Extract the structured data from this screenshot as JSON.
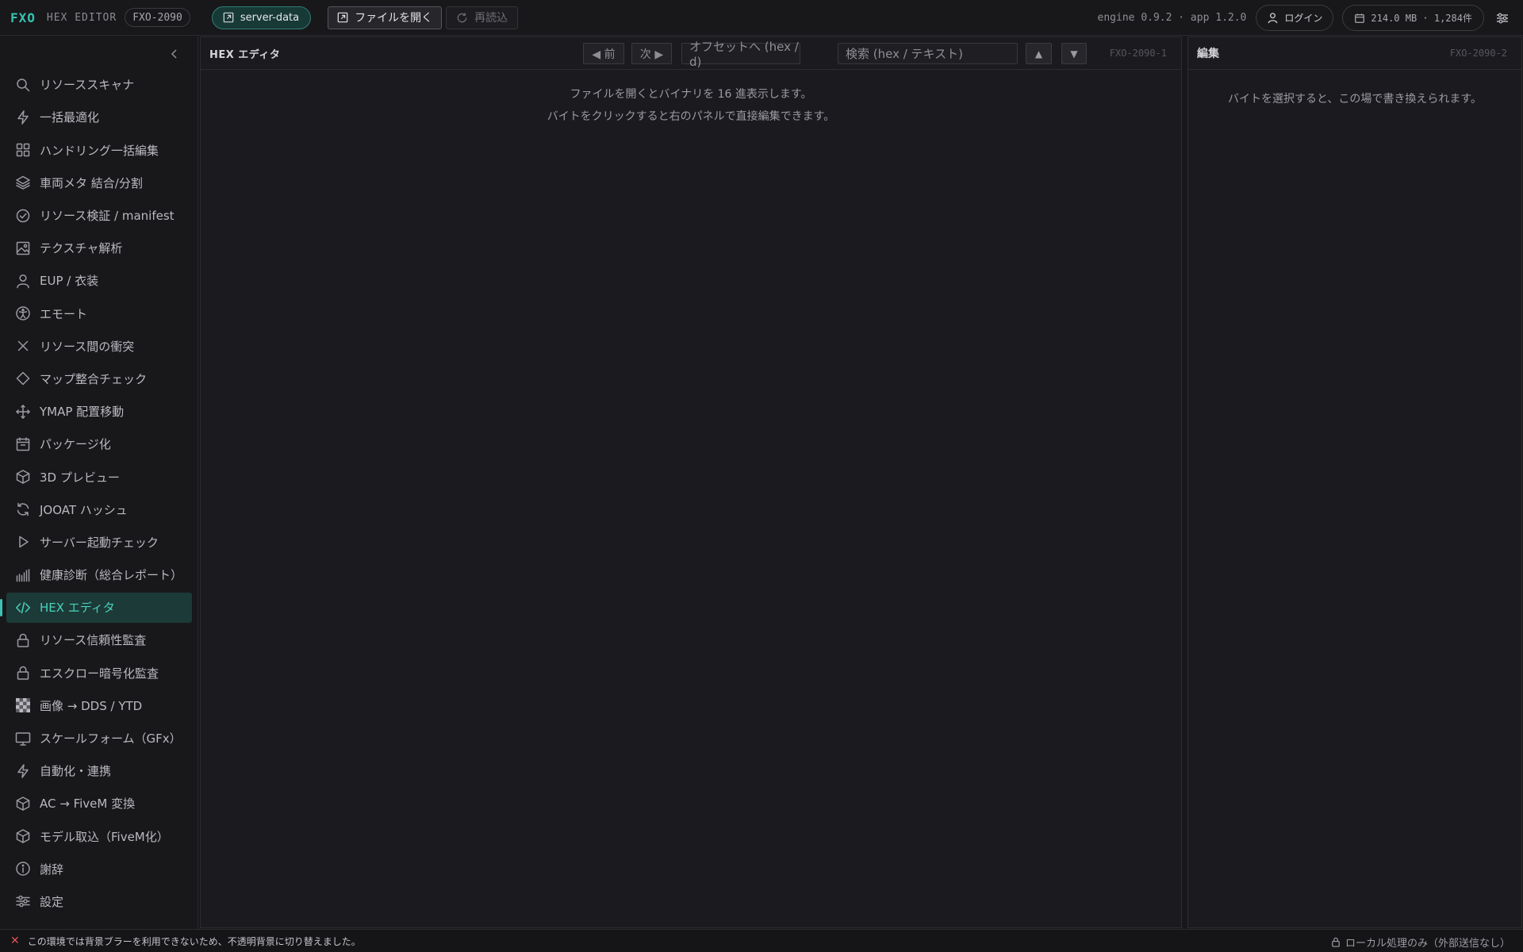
{
  "header": {
    "brand": "FXO",
    "subtitle": "HEX EDITOR",
    "build_id": "FXO-2090",
    "server_button": "server-data",
    "open_file_button": "ファイルを開く",
    "reload_button": "再読込",
    "version": "engine 0.9.2 · app 1.2.0",
    "login_button": "ログイン",
    "memory": "214.0 MB · 1,284件"
  },
  "sidebar": {
    "items": [
      {
        "label": "リソーススキャナ",
        "icon": "search-icon"
      },
      {
        "label": "一括最適化",
        "icon": "bolt-icon"
      },
      {
        "label": "ハンドリング一括編集",
        "icon": "grid-icon"
      },
      {
        "label": "車両メタ 結合/分割",
        "icon": "layers-icon"
      },
      {
        "label": "リソース検証 / manifest",
        "icon": "check-circle-icon"
      },
      {
        "label": "テクスチャ解析",
        "icon": "image-icon"
      },
      {
        "label": "EUP / 衣装",
        "icon": "user-icon"
      },
      {
        "label": "エモート",
        "icon": "accessibility-icon"
      },
      {
        "label": "リソース間の衝突",
        "icon": "x-icon"
      },
      {
        "label": "マップ整合チェック",
        "icon": "diamond-icon"
      },
      {
        "label": "YMAP 配置移動",
        "icon": "move-icon"
      },
      {
        "label": "パッケージ化",
        "icon": "package-icon"
      },
      {
        "label": "3D プレビュー",
        "icon": "cube-icon"
      },
      {
        "label": "JOOAT ハッシュ",
        "icon": "refresh-icon"
      },
      {
        "label": "サーバー起動チェック",
        "icon": "play-icon"
      },
      {
        "label": "健康診断（総合レポート）",
        "icon": "bars-icon"
      },
      {
        "label": "HEX エディタ",
        "icon": "code-icon",
        "active": true
      },
      {
        "label": "リソース信頼性監査",
        "icon": "lock-icon"
      },
      {
        "label": "エスクロー暗号化監査",
        "icon": "lock-icon"
      },
      {
        "label": "画像 → DDS / YTD",
        "icon": "checker-icon"
      },
      {
        "label": "スケールフォーム（GFx）",
        "icon": "monitor-icon"
      },
      {
        "label": "自動化・連携",
        "icon": "bolt-icon"
      },
      {
        "label": "AC → FiveM 変換",
        "icon": "cube-icon"
      },
      {
        "label": "モデル取込（FiveM化）",
        "icon": "cube-icon"
      },
      {
        "label": "謝辞",
        "icon": "info-icon"
      },
      {
        "label": "設定",
        "icon": "sliders-icon"
      }
    ]
  },
  "hex_panel": {
    "title": "HEX エディタ",
    "prev_button": "◀ 前",
    "next_button": "次 ▶",
    "offset_placeholder": "オフセットへ (hex / d)",
    "search_placeholder": "検索 (hex / テキスト)",
    "up_button": "▲",
    "down_button": "▼",
    "panel_id": "FXO-2090-1",
    "hint_line1": "ファイルを開くとバイナリを 16 進表示します。",
    "hint_line2": "バイトをクリックすると右のパネルで直接編集できます。"
  },
  "edit_panel": {
    "title": "編集",
    "panel_id": "FXO-2090-2",
    "hint": "バイトを選択すると、この場で書き換えられます。"
  },
  "status": {
    "message": "この環境では背景ブラーを利用できないため、不透明背景に切り替えました。",
    "right": "ローカル処理のみ（外部送信なし）"
  },
  "colors": {
    "accent": "#35c4b0",
    "background": "#18181b",
    "error": "#e05252"
  }
}
